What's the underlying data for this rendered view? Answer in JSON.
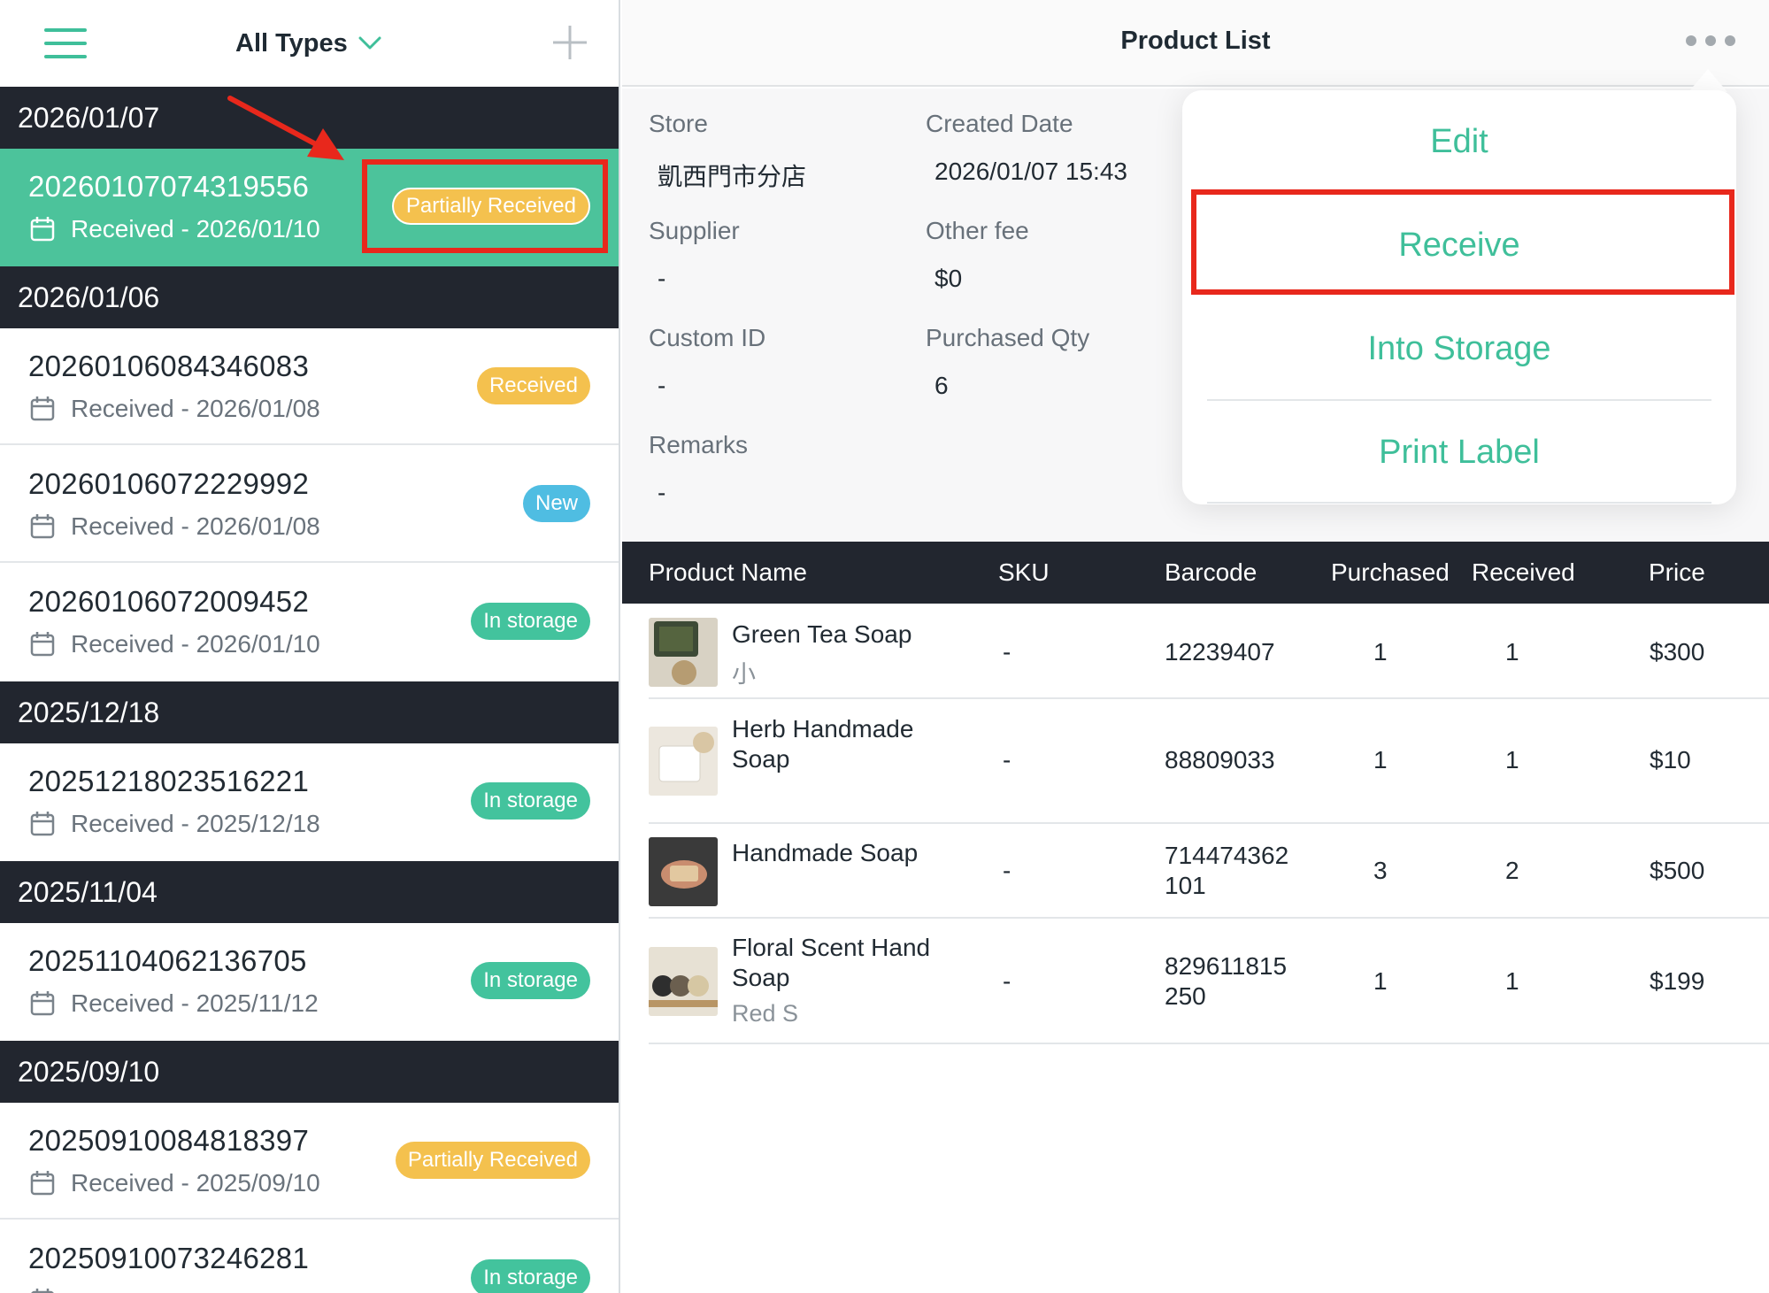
{
  "left_header": {
    "filter_label": "All Types",
    "menu_icon": "hamburger-icon",
    "filter_icon": "chevron-down-icon",
    "add_icon": "plus-icon"
  },
  "groups": [
    {
      "date": "2026/01/07"
    },
    {
      "date": "2026/01/06"
    },
    {
      "date": "2025/12/18"
    },
    {
      "date": "2025/11/04"
    },
    {
      "date": "2025/09/10"
    }
  ],
  "orders": [
    {
      "id": "20260107074319556",
      "received": "Received - 2026/01/10",
      "status": "Partially Received",
      "selected": true
    },
    {
      "id": "20260106084346083",
      "received": "Received - 2026/01/08",
      "status": "Received"
    },
    {
      "id": "20260106072229992",
      "received": "Received - 2026/01/08",
      "status": "New"
    },
    {
      "id": "20260106072009452",
      "received": "Received - 2026/01/10",
      "status": "In storage"
    },
    {
      "id": "20251218023516221",
      "received": "Received - 2025/12/18",
      "status": "In storage"
    },
    {
      "id": "20251104062136705",
      "received": "Received - 2025/11/12",
      "status": "In storage"
    },
    {
      "id": "20250910084818397",
      "received": "Received - 2025/09/10",
      "status": "Partially Received"
    },
    {
      "id": "20250910073246281",
      "received": "",
      "status": "In storage"
    }
  ],
  "right_header": {
    "title": "Product List",
    "more_icon": "more-horizontal-icon"
  },
  "details": {
    "store_label": "Store",
    "store_value": "凱西門市分店",
    "created_label": "Created Date",
    "created_value": "2026/01/07 15:43",
    "supplier_label": "Supplier",
    "supplier_value": "-",
    "other_fee_label": "Other fee",
    "other_fee_value": "$0",
    "custom_id_label": "Custom ID",
    "custom_id_value": "-",
    "purchased_qty_label": "Purchased Qty",
    "purchased_qty_value": "6",
    "remarks_label": "Remarks",
    "remarks_value": "-"
  },
  "table": {
    "headers": {
      "name": "Product Name",
      "sku": "SKU",
      "barcode": "Barcode",
      "purchased": "Purchased",
      "received": "Received",
      "price": "Price"
    },
    "rows": [
      {
        "name": "Green Tea Soap",
        "variant": "小",
        "sku": "-",
        "barcode": "12239407",
        "purchased": "1",
        "received": "1",
        "price": "$300"
      },
      {
        "name": "Herb Handmade Soap",
        "variant": "",
        "sku": "-",
        "barcode": "88809033",
        "purchased": "1",
        "received": "1",
        "price": "$10"
      },
      {
        "name": "Handmade Soap",
        "variant": "",
        "sku": "-",
        "barcode": "714474362 101",
        "purchased": "3",
        "received": "2",
        "price": "$500"
      },
      {
        "name": "Floral Scent Hand Soap",
        "variant": "Red S",
        "sku": "-",
        "barcode": "829611815 250",
        "purchased": "1",
        "received": "1",
        "price": "$199"
      }
    ]
  },
  "menu": {
    "edit": "Edit",
    "receive": "Receive",
    "into_storage": "Into Storage",
    "print_label": "Print Label"
  },
  "colors": {
    "accent": "#3fbf9a",
    "selected_row": "#4cc39b",
    "dark_header": "#22262f",
    "badge_yellow": "#f4c14e",
    "badge_blue": "#4fbde2",
    "badge_green": "#43c39d",
    "highlight_red": "#e8281c"
  }
}
